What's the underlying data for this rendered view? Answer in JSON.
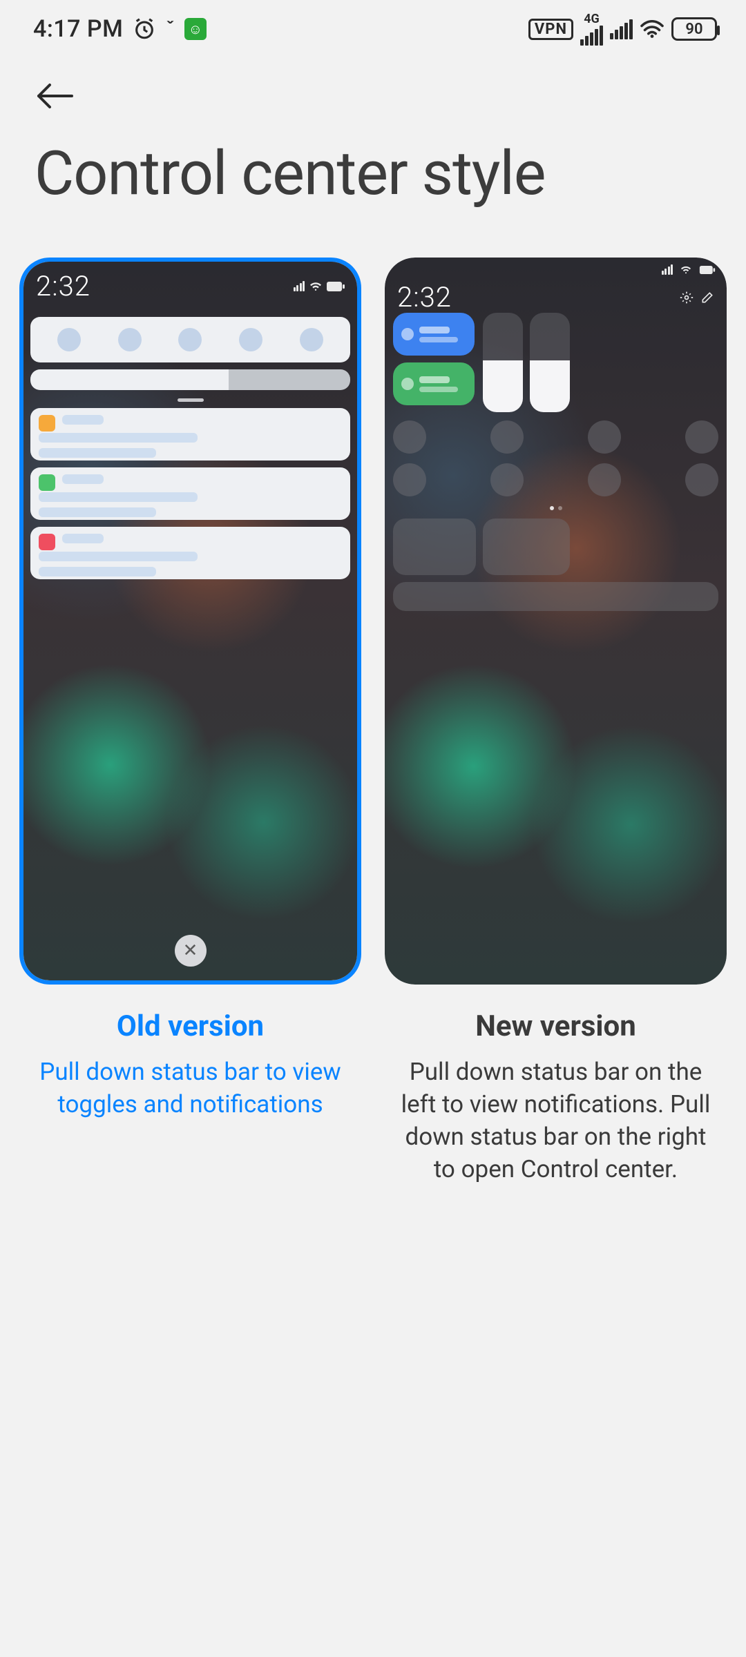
{
  "status_bar": {
    "time": "4:17 PM",
    "vpn": "VPN",
    "net_label": "4G",
    "battery": "90"
  },
  "page": {
    "title": "Control center style"
  },
  "options": [
    {
      "key": "old",
      "title": "Old version",
      "description": "Pull down status bar to view toggles and notifications",
      "selected": true,
      "preview_time": "2:32"
    },
    {
      "key": "new",
      "title": "New version",
      "description": "Pull down status bar on the left to view notifications. Pull down status bar on the right to open Control center.",
      "selected": false,
      "preview_time": "2:32"
    }
  ]
}
